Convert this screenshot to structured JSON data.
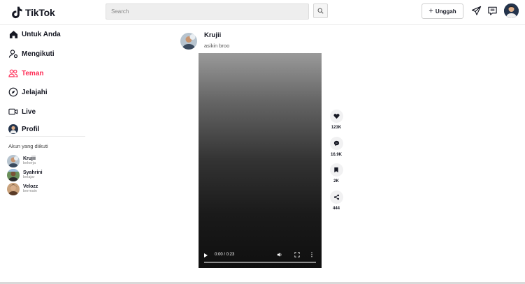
{
  "header": {
    "logo_text": "TikTok",
    "search_placeholder": "Search",
    "upload_plus": "+",
    "upload_label": "Unggah"
  },
  "sidebar": {
    "nav": [
      {
        "label": "Untuk Anda",
        "icon": "home-icon",
        "active": false
      },
      {
        "label": "Mengikuti",
        "icon": "following-icon",
        "active": false
      },
      {
        "label": "Teman",
        "icon": "friends-icon",
        "active": true
      },
      {
        "label": "Jelajahi",
        "icon": "explore-icon",
        "active": false
      },
      {
        "label": "Live",
        "icon": "live-icon",
        "active": false
      },
      {
        "label": "Profil",
        "icon": "profile-avatar",
        "active": false
      }
    ],
    "following_title": "Akun yang diikuti",
    "accounts": [
      {
        "name": "Krujii",
        "sub": "bekerja"
      },
      {
        "name": "Syahrini",
        "sub": "belajar"
      },
      {
        "name": "Velozz",
        "sub": "bermain"
      }
    ]
  },
  "post": {
    "username": "Krujii",
    "caption": "asikin broo",
    "video": {
      "time": "0:00 / 0:23",
      "progress": 0
    },
    "actions": [
      {
        "icon": "heart-icon",
        "count": "123K"
      },
      {
        "icon": "comment-icon",
        "count": "16.9K"
      },
      {
        "icon": "bookmark-icon",
        "count": "2K"
      },
      {
        "icon": "share-icon",
        "count": "444"
      }
    ]
  },
  "colors": {
    "accent": "#fe2c55",
    "text": "#161823"
  }
}
